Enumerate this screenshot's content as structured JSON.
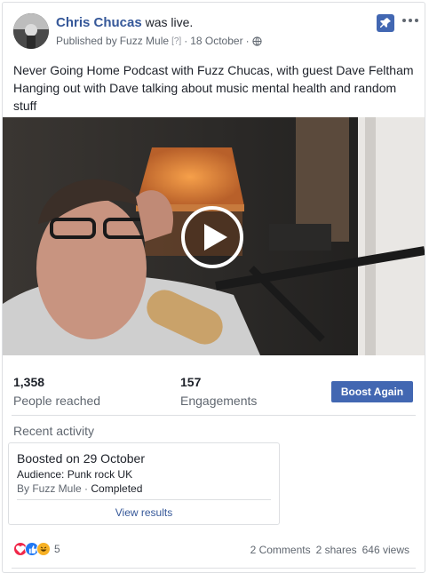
{
  "post": {
    "author": "Chris Chucas",
    "action": "was live.",
    "published_by_prefix": "Published by",
    "publisher": "Fuzz Mule",
    "help_marker": "[?]",
    "separator": "·",
    "date": "18 October",
    "privacy_icon": "globe-icon",
    "text": "Never Going Home Podcast with Fuzz Chucas, with guest Dave Feltham Hanging out with Dave talking about music mental health and random stuff"
  },
  "header_actions": {
    "pin_icon": "pin-icon",
    "more_icon": "more-options-icon"
  },
  "video": {
    "play_icon": "play-icon"
  },
  "stats": {
    "reached_value": "1,358",
    "reached_label": "People reached",
    "engagements_value": "157",
    "engagements_label": "Engagements",
    "boost_label": "Boost Again"
  },
  "recent": {
    "title": "Recent activity",
    "boost_title": "Boosted on 29 October",
    "audience": "Audience: Punk rock UK",
    "by": "By Fuzz Mule",
    "separator": "·",
    "status": "Completed",
    "view_results": "View results"
  },
  "engagement": {
    "reaction_icons": [
      "love-reaction-icon",
      "like-reaction-icon",
      "haha-reaction-icon"
    ],
    "reaction_count": "5",
    "comments": "2 Comments",
    "shares": "2 shares",
    "views": "646 views"
  },
  "colors": {
    "link": "#365899",
    "button": "#4267b2",
    "secondary_text": "#606770",
    "border": "#dddfe2"
  }
}
